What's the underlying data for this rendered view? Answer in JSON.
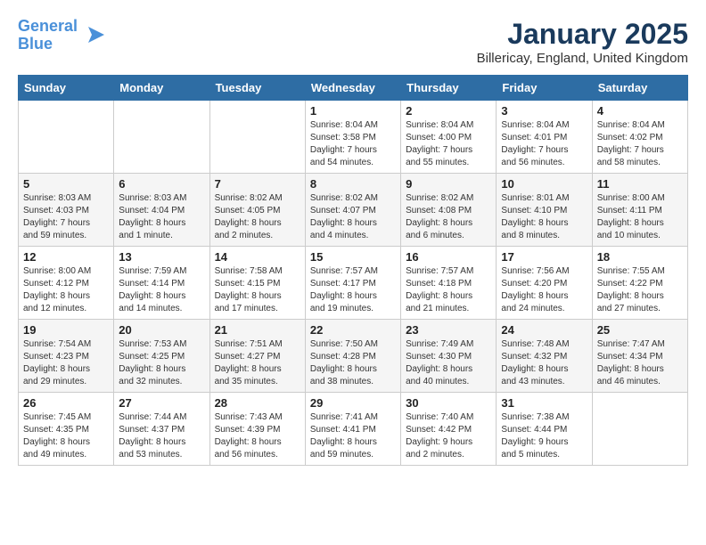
{
  "header": {
    "logo_line1": "General",
    "logo_line2": "Blue",
    "month_title": "January 2025",
    "location": "Billericay, England, United Kingdom"
  },
  "weekdays": [
    "Sunday",
    "Monday",
    "Tuesday",
    "Wednesday",
    "Thursday",
    "Friday",
    "Saturday"
  ],
  "weeks": [
    [
      {
        "day": "",
        "info": ""
      },
      {
        "day": "",
        "info": ""
      },
      {
        "day": "",
        "info": ""
      },
      {
        "day": "1",
        "info": "Sunrise: 8:04 AM\nSunset: 3:58 PM\nDaylight: 7 hours\nand 54 minutes."
      },
      {
        "day": "2",
        "info": "Sunrise: 8:04 AM\nSunset: 4:00 PM\nDaylight: 7 hours\nand 55 minutes."
      },
      {
        "day": "3",
        "info": "Sunrise: 8:04 AM\nSunset: 4:01 PM\nDaylight: 7 hours\nand 56 minutes."
      },
      {
        "day": "4",
        "info": "Sunrise: 8:04 AM\nSunset: 4:02 PM\nDaylight: 7 hours\nand 58 minutes."
      }
    ],
    [
      {
        "day": "5",
        "info": "Sunrise: 8:03 AM\nSunset: 4:03 PM\nDaylight: 7 hours\nand 59 minutes."
      },
      {
        "day": "6",
        "info": "Sunrise: 8:03 AM\nSunset: 4:04 PM\nDaylight: 8 hours\nand 1 minute."
      },
      {
        "day": "7",
        "info": "Sunrise: 8:02 AM\nSunset: 4:05 PM\nDaylight: 8 hours\nand 2 minutes."
      },
      {
        "day": "8",
        "info": "Sunrise: 8:02 AM\nSunset: 4:07 PM\nDaylight: 8 hours\nand 4 minutes."
      },
      {
        "day": "9",
        "info": "Sunrise: 8:02 AM\nSunset: 4:08 PM\nDaylight: 8 hours\nand 6 minutes."
      },
      {
        "day": "10",
        "info": "Sunrise: 8:01 AM\nSunset: 4:10 PM\nDaylight: 8 hours\nand 8 minutes."
      },
      {
        "day": "11",
        "info": "Sunrise: 8:00 AM\nSunset: 4:11 PM\nDaylight: 8 hours\nand 10 minutes."
      }
    ],
    [
      {
        "day": "12",
        "info": "Sunrise: 8:00 AM\nSunset: 4:12 PM\nDaylight: 8 hours\nand 12 minutes."
      },
      {
        "day": "13",
        "info": "Sunrise: 7:59 AM\nSunset: 4:14 PM\nDaylight: 8 hours\nand 14 minutes."
      },
      {
        "day": "14",
        "info": "Sunrise: 7:58 AM\nSunset: 4:15 PM\nDaylight: 8 hours\nand 17 minutes."
      },
      {
        "day": "15",
        "info": "Sunrise: 7:57 AM\nSunset: 4:17 PM\nDaylight: 8 hours\nand 19 minutes."
      },
      {
        "day": "16",
        "info": "Sunrise: 7:57 AM\nSunset: 4:18 PM\nDaylight: 8 hours\nand 21 minutes."
      },
      {
        "day": "17",
        "info": "Sunrise: 7:56 AM\nSunset: 4:20 PM\nDaylight: 8 hours\nand 24 minutes."
      },
      {
        "day": "18",
        "info": "Sunrise: 7:55 AM\nSunset: 4:22 PM\nDaylight: 8 hours\nand 27 minutes."
      }
    ],
    [
      {
        "day": "19",
        "info": "Sunrise: 7:54 AM\nSunset: 4:23 PM\nDaylight: 8 hours\nand 29 minutes."
      },
      {
        "day": "20",
        "info": "Sunrise: 7:53 AM\nSunset: 4:25 PM\nDaylight: 8 hours\nand 32 minutes."
      },
      {
        "day": "21",
        "info": "Sunrise: 7:51 AM\nSunset: 4:27 PM\nDaylight: 8 hours\nand 35 minutes."
      },
      {
        "day": "22",
        "info": "Sunrise: 7:50 AM\nSunset: 4:28 PM\nDaylight: 8 hours\nand 38 minutes."
      },
      {
        "day": "23",
        "info": "Sunrise: 7:49 AM\nSunset: 4:30 PM\nDaylight: 8 hours\nand 40 minutes."
      },
      {
        "day": "24",
        "info": "Sunrise: 7:48 AM\nSunset: 4:32 PM\nDaylight: 8 hours\nand 43 minutes."
      },
      {
        "day": "25",
        "info": "Sunrise: 7:47 AM\nSunset: 4:34 PM\nDaylight: 8 hours\nand 46 minutes."
      }
    ],
    [
      {
        "day": "26",
        "info": "Sunrise: 7:45 AM\nSunset: 4:35 PM\nDaylight: 8 hours\nand 49 minutes."
      },
      {
        "day": "27",
        "info": "Sunrise: 7:44 AM\nSunset: 4:37 PM\nDaylight: 8 hours\nand 53 minutes."
      },
      {
        "day": "28",
        "info": "Sunrise: 7:43 AM\nSunset: 4:39 PM\nDaylight: 8 hours\nand 56 minutes."
      },
      {
        "day": "29",
        "info": "Sunrise: 7:41 AM\nSunset: 4:41 PM\nDaylight: 8 hours\nand 59 minutes."
      },
      {
        "day": "30",
        "info": "Sunrise: 7:40 AM\nSunset: 4:42 PM\nDaylight: 9 hours\nand 2 minutes."
      },
      {
        "day": "31",
        "info": "Sunrise: 7:38 AM\nSunset: 4:44 PM\nDaylight: 9 hours\nand 5 minutes."
      },
      {
        "day": "",
        "info": ""
      }
    ]
  ]
}
